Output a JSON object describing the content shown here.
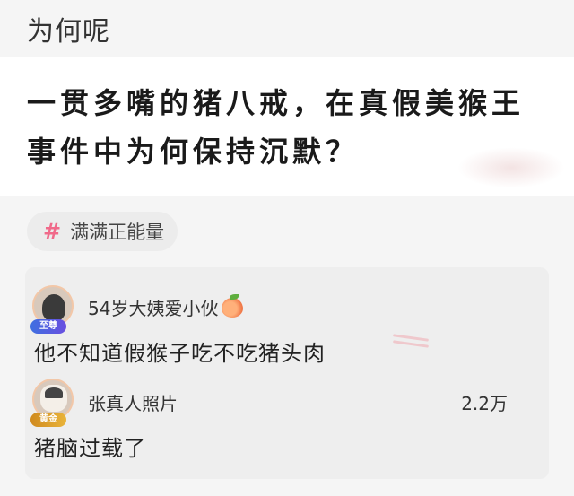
{
  "header": {
    "title": "为何呢"
  },
  "question": {
    "text": "一贯多嘴的猪八戒，在真假美猴王事件中为何保持沉默？"
  },
  "topic": {
    "icon": "hash-icon",
    "label": "满满正能量",
    "icon_color": "#f06a8a"
  },
  "comments": [
    {
      "username": "54岁大姨爱小伙",
      "badge": "至尊",
      "emoji": "peach-icon",
      "text": "他不知道假猴子吃不吃猪头肉",
      "likes": ""
    },
    {
      "username": "张真人照片",
      "badge": "黄金",
      "text": "猪脑过载了",
      "likes": "2.2万"
    }
  ]
}
